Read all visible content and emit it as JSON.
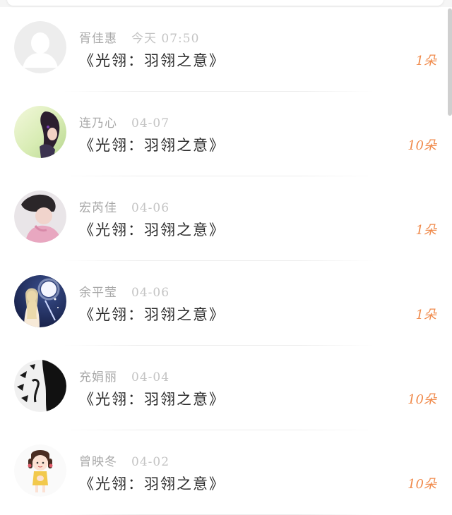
{
  "gifts": [
    {
      "name": "胥佳惠",
      "time": "今天 07:50",
      "title": "《光翎：羽翎之意》",
      "count": "1朵",
      "avatar_icon": "default-user-avatar"
    },
    {
      "name": "连乃心",
      "time": "04-07",
      "title": "《光翎：羽翎之意》",
      "count": "10朵",
      "avatar_icon": "girl-photo-avatar"
    },
    {
      "name": "宏芮佳",
      "time": "04-06",
      "title": "《光翎：羽翎之意》",
      "count": "1朵",
      "avatar_icon": "child-photo-avatar"
    },
    {
      "name": "余平莹",
      "time": "04-06",
      "title": "《光翎：羽翎之意》",
      "count": "1朵",
      "avatar_icon": "moon-fairy-avatar"
    },
    {
      "name": "充娟丽",
      "time": "04-04",
      "title": "《光翎：羽翎之意》",
      "count": "10朵",
      "avatar_icon": "black-white-art-avatar"
    },
    {
      "name": "曾映冬",
      "time": "04-02",
      "title": "《光翎：羽翎之意》",
      "count": "10朵",
      "avatar_icon": "cartoon-girl-avatar"
    }
  ],
  "colors": {
    "accent": "#f08a4b",
    "name_text": "#a8a8a8",
    "title_text": "#2a2a2a"
  }
}
